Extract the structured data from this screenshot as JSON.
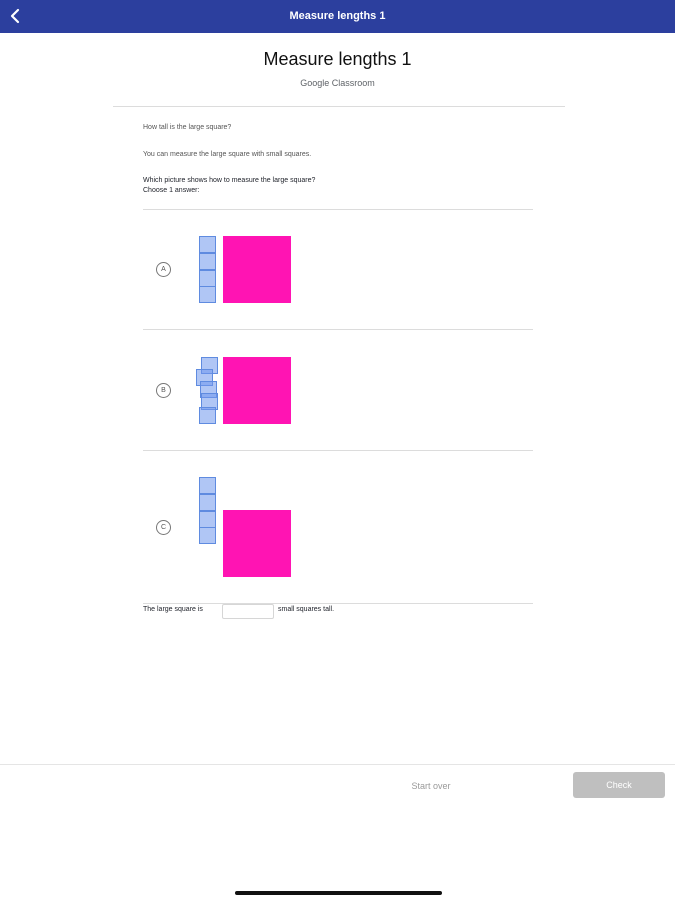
{
  "header": {
    "title": "Measure lengths 1",
    "back_icon": "chevron-left-icon",
    "bar_color": "#2c3f9e"
  },
  "page": {
    "title": "Measure lengths 1",
    "subtitle": "Google Classroom"
  },
  "question": {
    "prompt": "How tall is the large square?",
    "hint": "You can measure the large square with small squares.",
    "instruction_line1": "Which picture shows how to measure the large square?",
    "instruction_line2": "Choose 1 answer:"
  },
  "options": [
    {
      "letter": "A"
    },
    {
      "letter": "B"
    },
    {
      "letter": "C"
    }
  ],
  "answer": {
    "prefix": "The large square is",
    "suffix": "small squares tall.",
    "value": ""
  },
  "footer": {
    "start_over_label": "Start over",
    "check_label": "Check"
  },
  "colors": {
    "large_square": "#ff14b3",
    "small_square": "#7098ec"
  }
}
